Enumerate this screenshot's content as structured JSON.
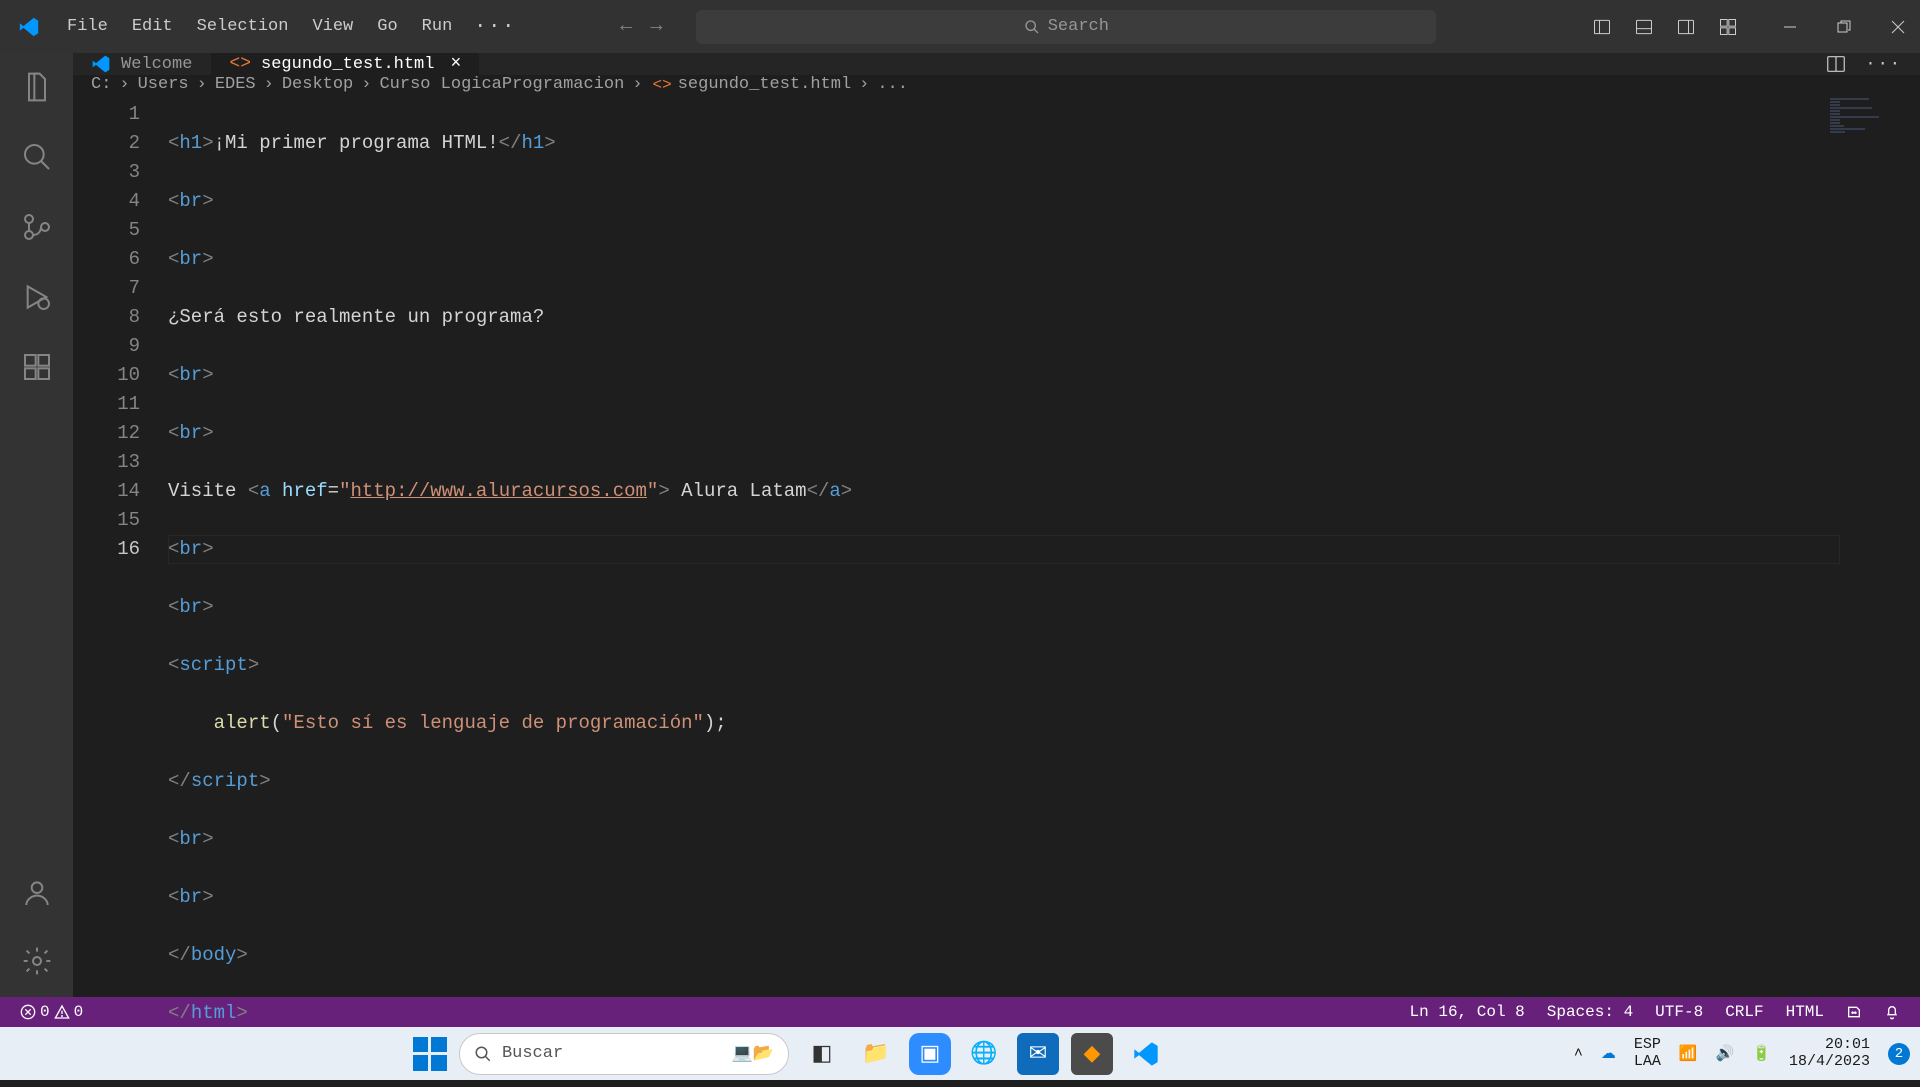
{
  "menus": {
    "file": "File",
    "edit": "Edit",
    "selection": "Selection",
    "view": "View",
    "go": "Go",
    "run": "Run"
  },
  "search_placeholder": "Search",
  "tabs": {
    "welcome": "Welcome",
    "active": "segundo_test.html"
  },
  "breadcrumbs": {
    "c": "C:",
    "users": "Users",
    "edes": "EDES",
    "desktop": "Desktop",
    "curso": "Curso LogicaProgramacion",
    "file": "segundo_test.html",
    "last": "..."
  },
  "code": {
    "l1_h1o": "h1",
    "l1_txt": "¡Mi primer programa HTML!",
    "l1_h1c": "h1",
    "l4_txt": "¿Será esto realmente un programa?",
    "l7_pre": "Visite ",
    "l7_a": "a",
    "l7_href": "href",
    "l7_eq": "=",
    "l7_q1": "\"",
    "l7_url": "http://www.aluracursos.com",
    "l7_q2": "\"",
    "l7_atxt": " Alura Latam",
    "l7_ac": "a",
    "l10_script": "script",
    "l11_indent": "    ",
    "l11_fn": "alert",
    "l11_op": "(",
    "l11_str": "\"Esto sí es lenguaje de programación\"",
    "l11_cp": ");",
    "l12_script": "script",
    "br": "br",
    "body": "body",
    "html": "html",
    "lt": "<",
    "gt": ">",
    "lts": "</"
  },
  "lines": [
    "1",
    "2",
    "3",
    "4",
    "5",
    "6",
    "7",
    "8",
    "9",
    "10",
    "11",
    "12",
    "13",
    "14",
    "15",
    "16"
  ],
  "status": {
    "errors": "0",
    "warnings": "0",
    "ln_col": "Ln 16, Col 8",
    "spaces": "Spaces: 4",
    "encoding": "UTF-8",
    "eol": "CRLF",
    "lang": "HTML"
  },
  "taskbar": {
    "search_placeholder": "Buscar",
    "lang1": "ESP",
    "lang2": "LAA",
    "time": "20:01",
    "date": "18/4/2023",
    "notif": "2"
  }
}
